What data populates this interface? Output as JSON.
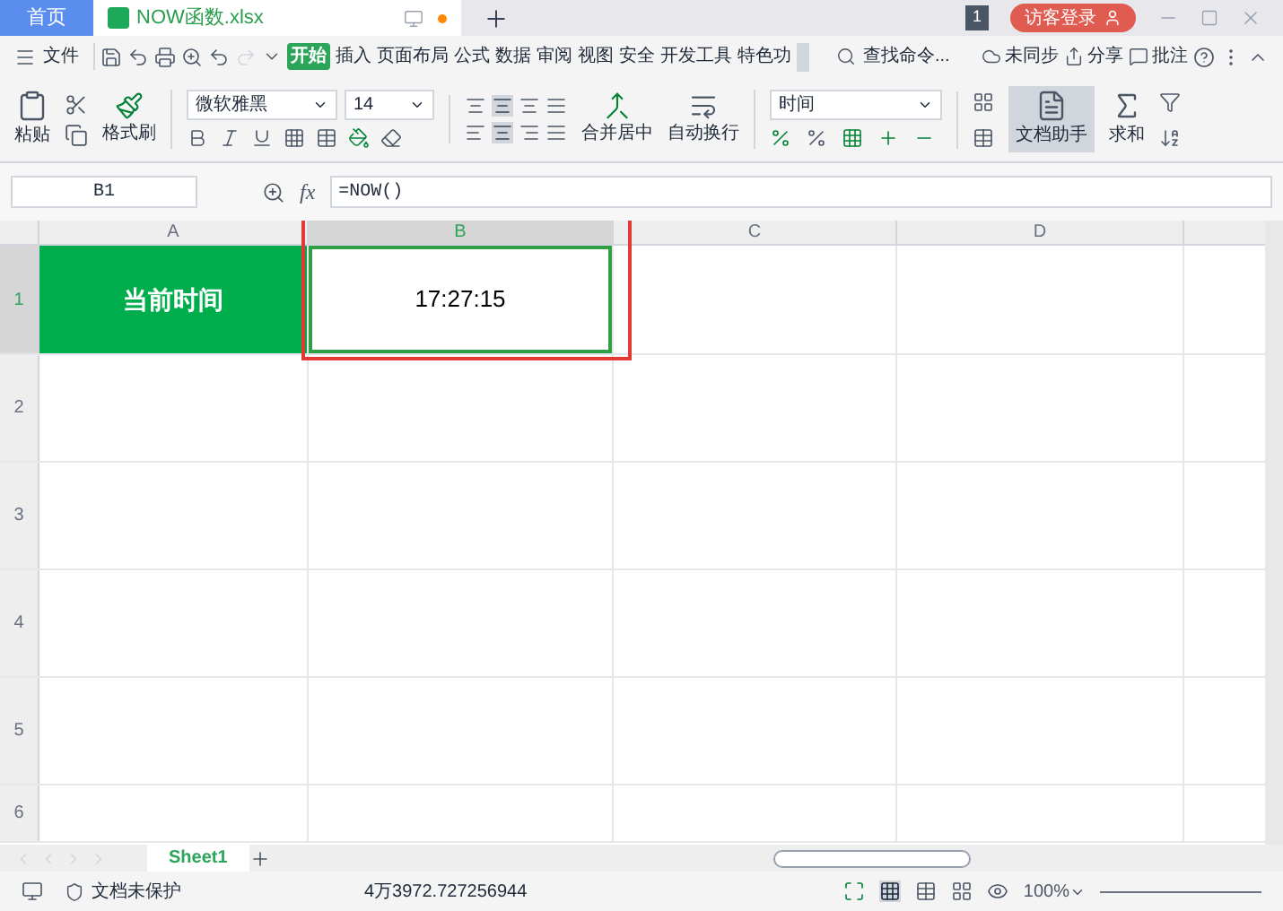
{
  "tabs": [
    {
      "label": "首页",
      "selected": false
    },
    {
      "label": "NOW函数.xlsx",
      "selected": true
    }
  ],
  "title_bar": {
    "badge": "1",
    "login": "访客登录"
  },
  "menu": {
    "file": "文件",
    "items": [
      {
        "label": "开始",
        "selected": true
      },
      {
        "label": "插入",
        "selected": false
      },
      {
        "label": "页面布局",
        "selected": false
      },
      {
        "label": "公式",
        "selected": false
      },
      {
        "label": "数据",
        "selected": false
      },
      {
        "label": "审阅",
        "selected": false
      },
      {
        "label": "视图",
        "selected": false
      },
      {
        "label": "安全",
        "selected": false
      },
      {
        "label": "开发工具",
        "selected": false
      },
      {
        "label": "特色功",
        "selected": false
      }
    ],
    "search": "查找命令...",
    "sync": "未同步",
    "share": "分享",
    "comment": "批注"
  },
  "ribbon": {
    "paste": "粘贴",
    "format_painter": "格式刷",
    "font": "微软雅黑",
    "font_size": "14",
    "merge": "合并居中",
    "wrap": "自动换行",
    "number_format": "时间",
    "doc_helper": "文档助手",
    "sum": "求和"
  },
  "formula_bar": {
    "name_box": "B1",
    "fx": "fx",
    "formula": "=NOW()"
  },
  "columns": [
    {
      "label": "A",
      "selected": false,
      "highlighted": false
    },
    {
      "label": "B",
      "selected": true,
      "highlighted": true
    },
    {
      "label": "C",
      "selected": false,
      "highlighted": false
    },
    {
      "label": "D",
      "selected": false,
      "highlighted": false
    }
  ],
  "rows": [
    {
      "label": "1",
      "selected": true,
      "cells": [
        {
          "kind": "heading",
          "text": "当前时间",
          "selected": false
        },
        {
          "kind": "value",
          "text": "17:27:15",
          "selected": true
        }
      ]
    },
    {
      "label": "2",
      "selected": false,
      "cells": []
    },
    {
      "label": "3",
      "selected": false,
      "cells": []
    },
    {
      "label": "4",
      "selected": false,
      "cells": []
    },
    {
      "label": "5",
      "selected": false,
      "cells": []
    },
    {
      "label": "6",
      "selected": false,
      "cells": []
    }
  ],
  "sheet_tabs": [
    {
      "label": "Sheet1",
      "selected": true
    }
  ],
  "status_bar": {
    "protection": "文档未保护",
    "sum": "4万3972.727256944",
    "zoom": "100%"
  }
}
